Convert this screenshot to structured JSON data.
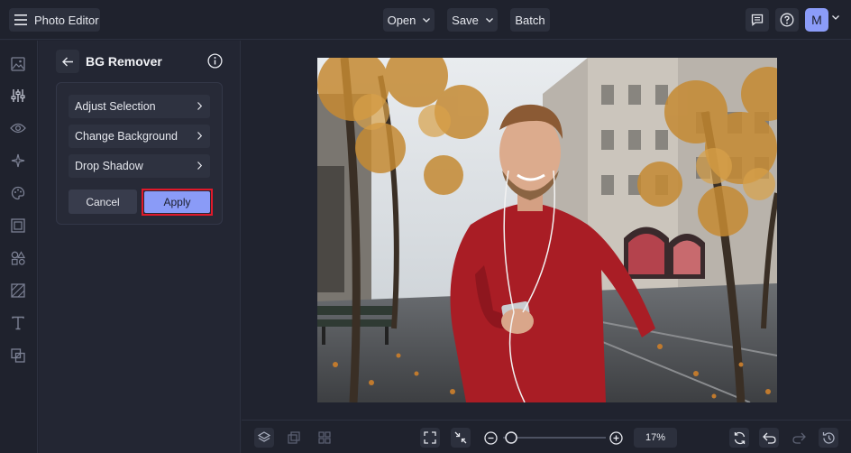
{
  "app": {
    "title": "Photo Editor",
    "menu_icon": "hamburger-icon"
  },
  "topbar": {
    "open_label": "Open",
    "save_label": "Save",
    "batch_label": "Batch",
    "feedback_icon": "feedback-icon",
    "help_icon": "help-icon",
    "avatar_letter": "M",
    "accent": "#8b9cf8"
  },
  "rail": {
    "items": [
      "image-icon",
      "adjustments-icon",
      "eye-icon",
      "sparkle-icon",
      "palette-icon",
      "frame-icon",
      "shapes-icon",
      "texture-icon",
      "text-icon",
      "overlay-icon"
    ]
  },
  "panel": {
    "title": "BG Remover",
    "options": [
      "Adjust Selection",
      "Change Background",
      "Drop Shadow"
    ],
    "cancel_label": "Cancel",
    "apply_label": "Apply",
    "highlight_color": "#e0192a"
  },
  "bottombar": {
    "zoom_label": "17%",
    "zoom_level": 0.03
  }
}
